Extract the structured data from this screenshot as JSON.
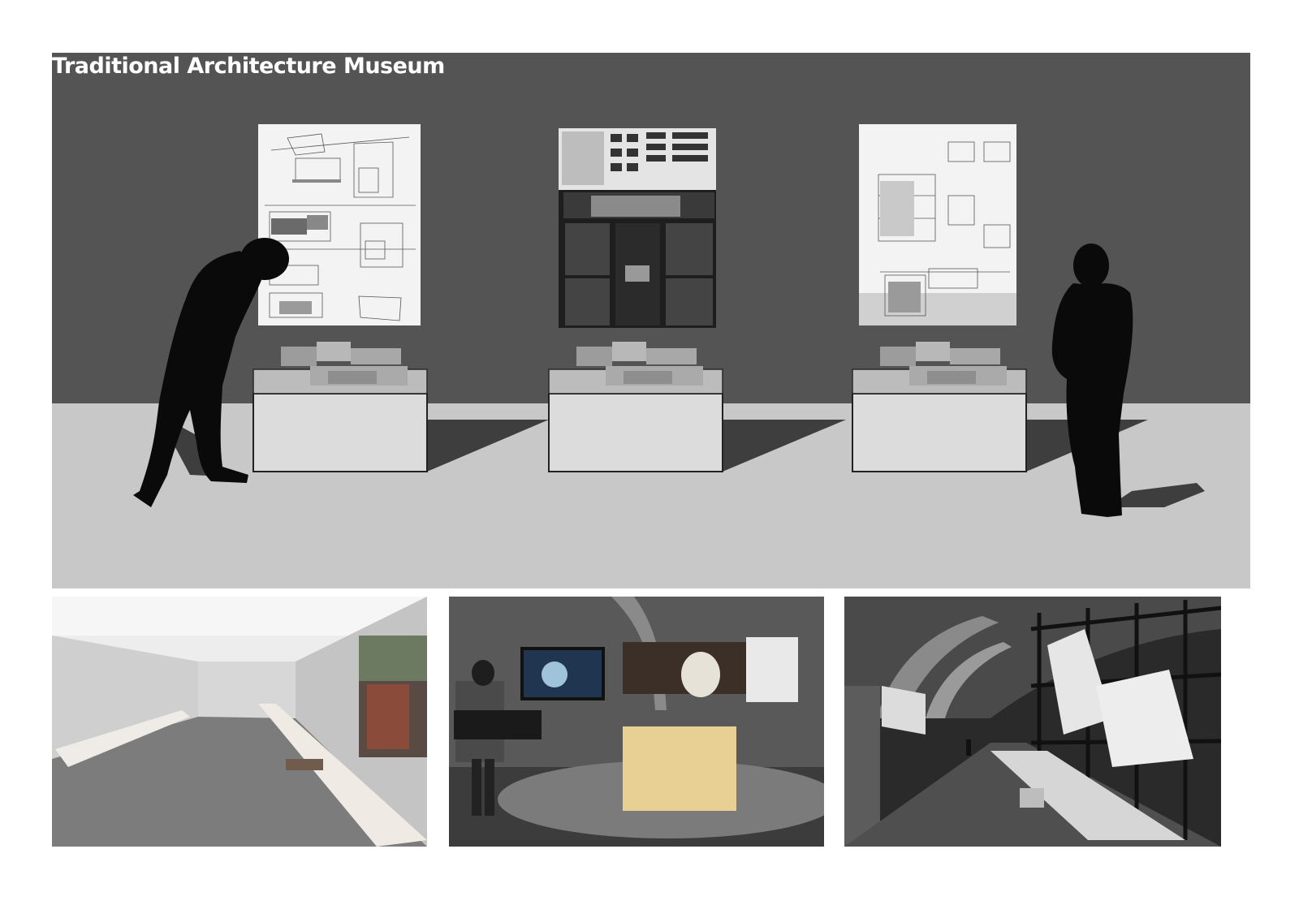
{
  "header": {
    "title": "Traditional Architecture Museum"
  },
  "colors": {
    "wall": "#545454",
    "floor": "#c8c8c8",
    "pedestal": "#dcdcdc",
    "silhouette": "#0a0a0a",
    "shadow": "#3e3e3e"
  },
  "scene": {
    "panels": [
      {
        "id": "panel-plans",
        "tone": "light"
      },
      {
        "id": "panel-drawings",
        "tone": "dark"
      },
      {
        "id": "panel-sections",
        "tone": "light"
      }
    ],
    "pedestals": [
      "pedestal-left",
      "pedestal-center",
      "pedestal-right"
    ],
    "figures": [
      "visitor-leaning",
      "visitor-standing"
    ]
  },
  "photos": [
    {
      "id": "photo-gallery-hall",
      "icon": "gallery-hall-photo"
    },
    {
      "id": "photo-media-exhibit",
      "icon": "media-exhibit-photo"
    },
    {
      "id": "photo-vaulted-corridor",
      "icon": "vaulted-corridor-photo"
    }
  ]
}
